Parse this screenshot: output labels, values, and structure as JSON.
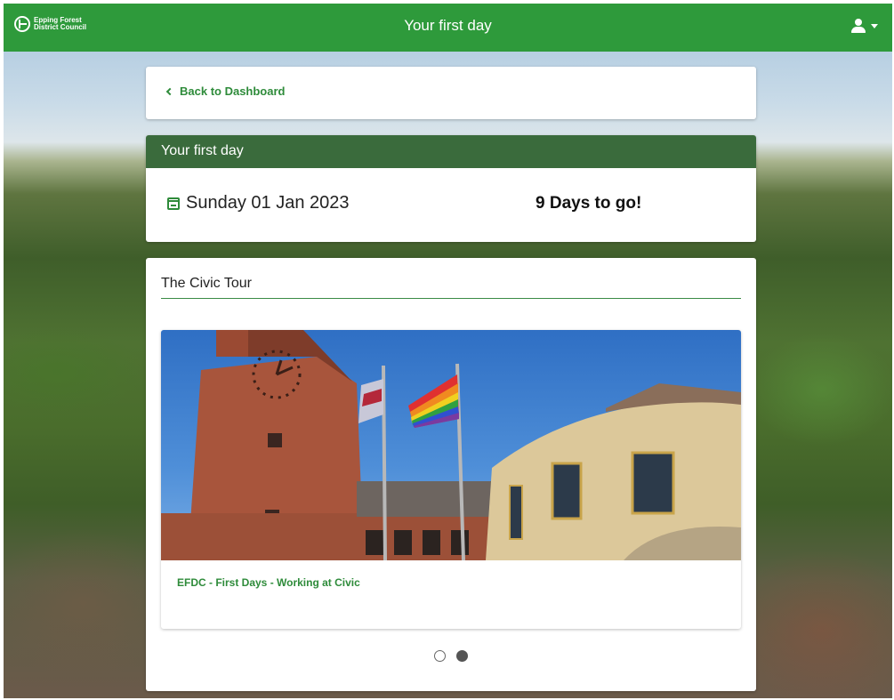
{
  "header": {
    "logo_line1": "Epping Forest",
    "logo_line2": "District Council",
    "title": "Your first day",
    "user_menu_icon": "user-icon",
    "user_menu_caret": "caret-down-icon"
  },
  "back": {
    "label": "Back to Dashboard",
    "icon": "chevron-left-icon"
  },
  "first_day": {
    "heading": "Your first day",
    "date": "Sunday 01 Jan 2023",
    "date_icon": "calendar-icon",
    "countdown": "9 Days to go!"
  },
  "tour": {
    "title": "The Civic Tour",
    "media_caption": "EFDC - First Days - Working at Civic",
    "carousel": {
      "count": 2,
      "active_index": 1
    }
  },
  "colors": {
    "primary_green": "#2e9a3b",
    "header_dark_green": "#3a6b3c",
    "link_green": "#2e8b3a"
  }
}
